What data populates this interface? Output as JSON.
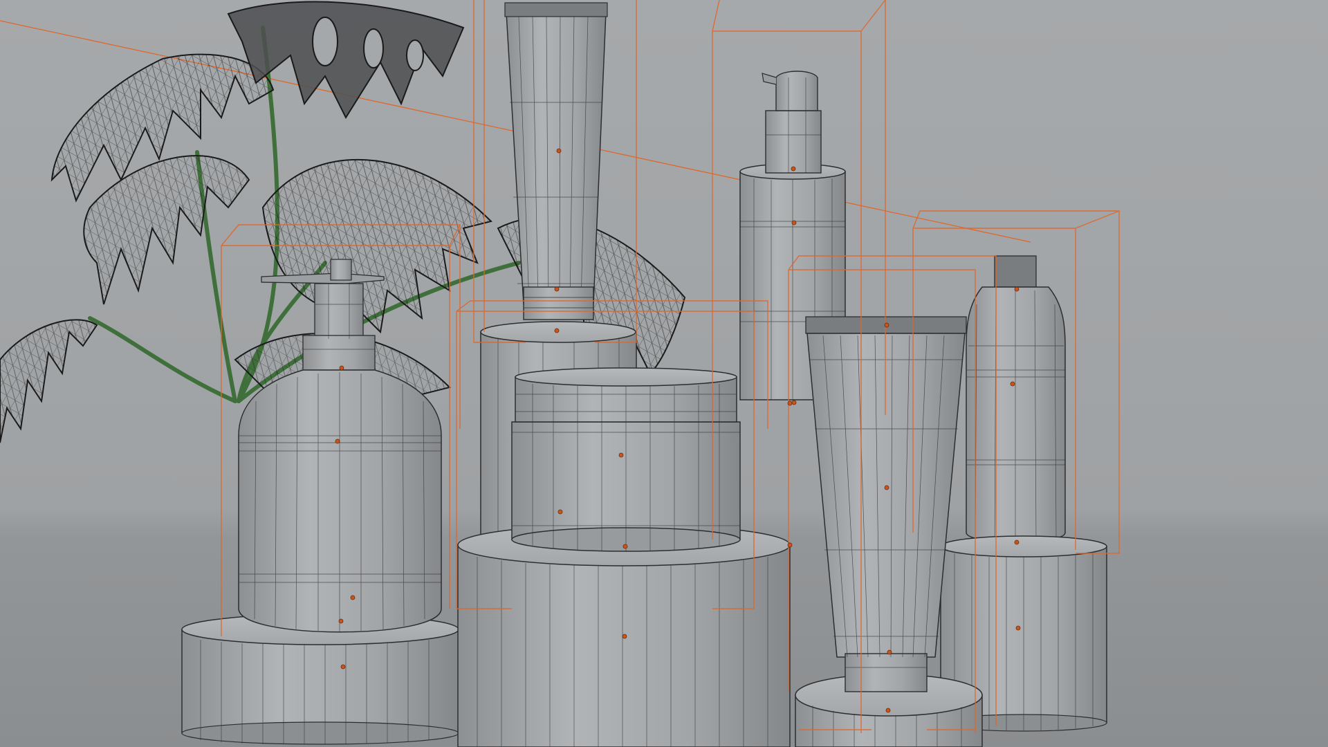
{
  "viewport": {
    "view": "perspective",
    "display_mode": "wireframe-on-shaded"
  },
  "colors": {
    "background_top": "#a5a8aa",
    "background_mid": "#9ea1a3",
    "floor": "#909395",
    "mesh_fill": "#a3a6a8",
    "mesh_line": "#2b2d2f",
    "leaf_line": "#1c1c1c",
    "stem": "#3f6f3a",
    "bbox": "#e0662a",
    "pivot": "#c9541d"
  },
  "scene_objects": [
    {
      "name": "monstera-plant",
      "type": "plant"
    },
    {
      "name": "pump-bottle",
      "type": "bottle"
    },
    {
      "name": "tall-tube",
      "type": "tube"
    },
    {
      "name": "airless-pump-bottle",
      "type": "bottle"
    },
    {
      "name": "cream-jar",
      "type": "jar"
    },
    {
      "name": "squeeze-tube",
      "type": "tube"
    },
    {
      "name": "small-bottle",
      "type": "bottle"
    },
    {
      "name": "podium-left",
      "type": "podium"
    },
    {
      "name": "podium-center",
      "type": "podium"
    },
    {
      "name": "podium-tube-riser",
      "type": "podium"
    },
    {
      "name": "podium-right",
      "type": "podium"
    },
    {
      "name": "podium-front",
      "type": "podium"
    }
  ]
}
